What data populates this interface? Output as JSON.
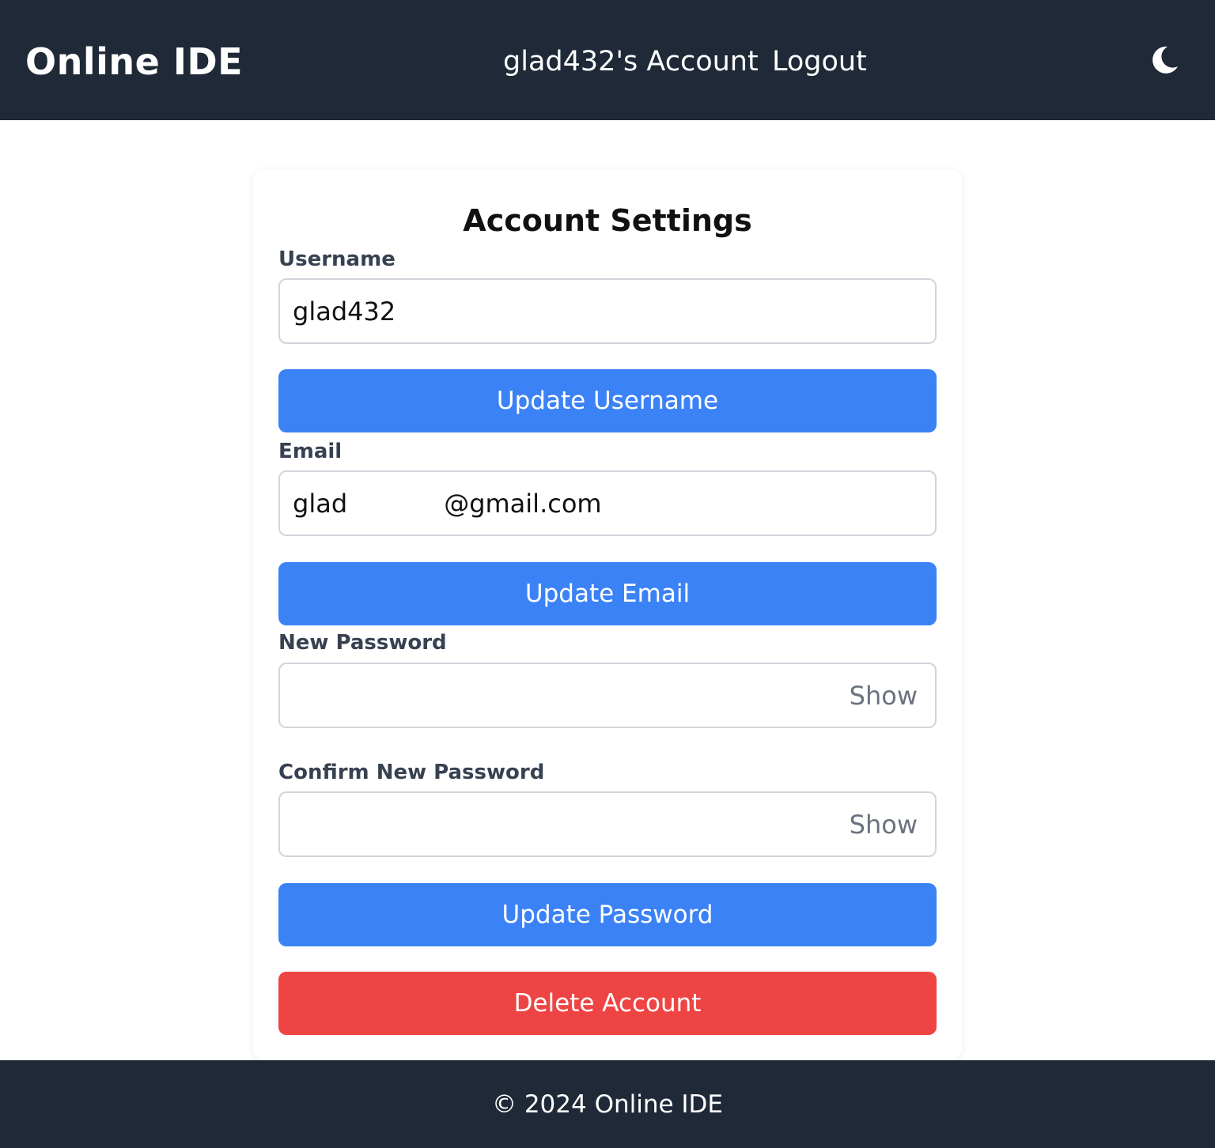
{
  "header": {
    "brand": "Online IDE",
    "account_link": "glad432's Account",
    "logout_link": "Logout",
    "theme_icon": "moon-icon"
  },
  "account_settings": {
    "title": "Account Settings",
    "username": {
      "label": "Username",
      "value": "glad432",
      "button": "Update Username"
    },
    "email": {
      "label": "Email",
      "value": "glad            @gmail.com",
      "button": "Update Email"
    },
    "new_password": {
      "label": "New Password",
      "value": "",
      "toggle": "Show"
    },
    "confirm_password": {
      "label": "Confirm New Password",
      "value": "",
      "toggle": "Show"
    },
    "update_password_button": "Update Password",
    "delete_account_button": "Delete Account"
  },
  "footer": {
    "text": "© 2024 Online IDE"
  },
  "colors": {
    "navbar_bg": "#1f2937",
    "primary_button": "#3b82f6",
    "danger_button": "#ef4444",
    "label_text": "#374151",
    "input_border": "#d1d5db",
    "toggle_text": "#6b7280"
  }
}
